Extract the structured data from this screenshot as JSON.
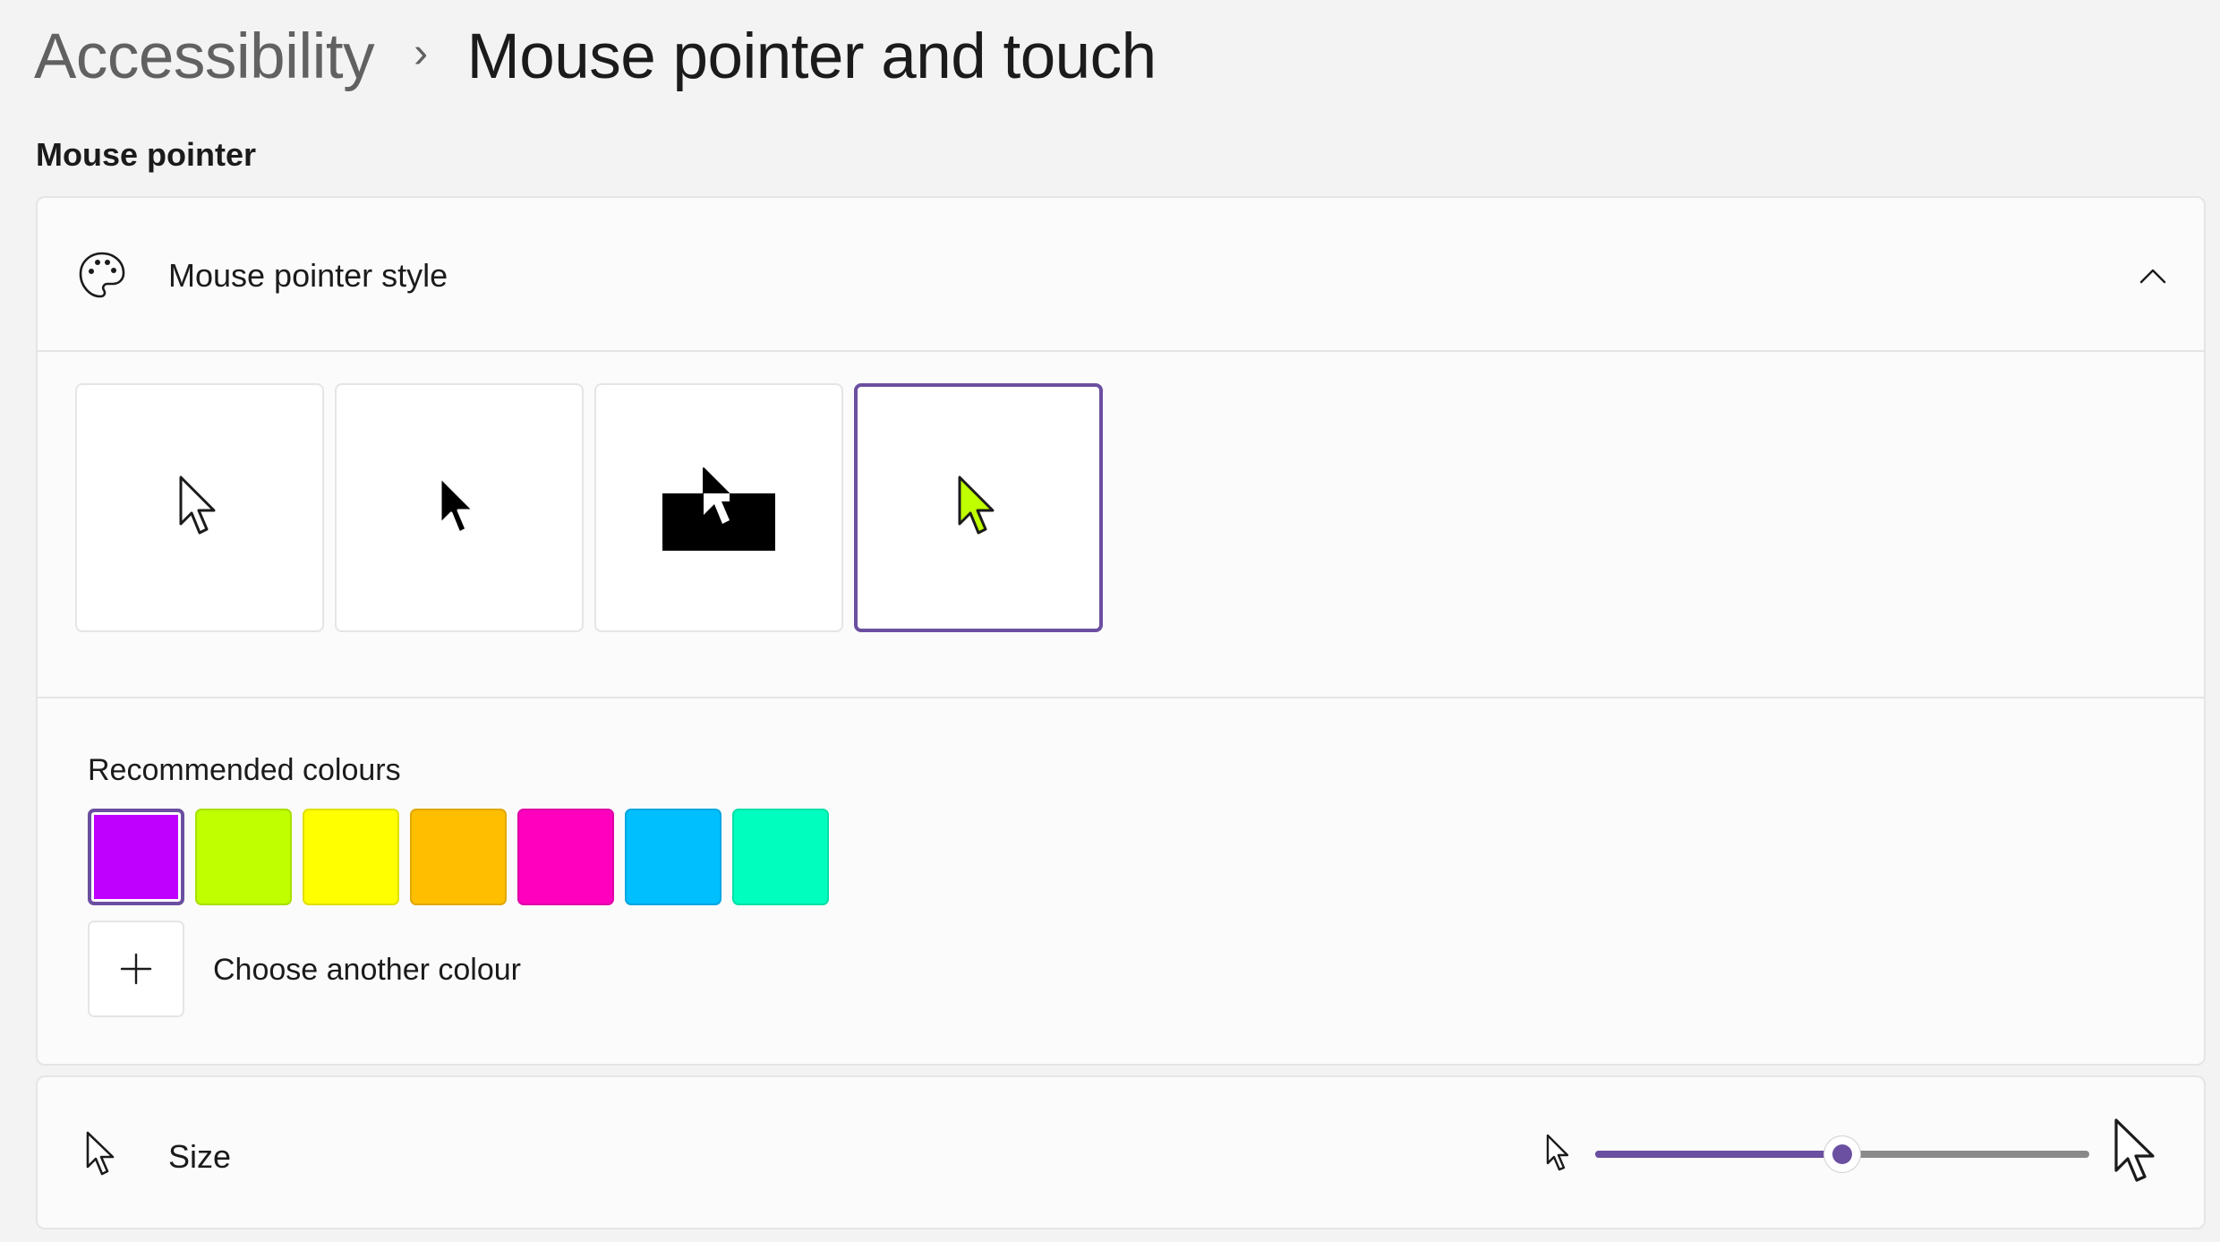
{
  "breadcrumb": {
    "parent": "Accessibility",
    "separator": "›",
    "current": "Mouse pointer and touch"
  },
  "section_title": "Mouse pointer",
  "pointer_style": {
    "label": "Mouse pointer style",
    "icon": "palette-icon",
    "expand_icon": "chevron-up-icon",
    "options": [
      {
        "name": "white",
        "selected": false
      },
      {
        "name": "black",
        "selected": false
      },
      {
        "name": "inverted",
        "selected": false
      },
      {
        "name": "custom",
        "selected": true
      }
    ]
  },
  "colours": {
    "label": "Recommended colours",
    "swatches": [
      {
        "color": "#bf00ff",
        "selected": true
      },
      {
        "color": "#bfff00",
        "selected": false
      },
      {
        "color": "#ffff00",
        "selected": false
      },
      {
        "color": "#ffbf00",
        "selected": false
      },
      {
        "color": "#ff00bf",
        "selected": false
      },
      {
        "color": "#00bfff",
        "selected": false
      },
      {
        "color": "#00ffbf",
        "selected": false
      }
    ],
    "add_label": "Choose another colour",
    "add_icon": "plus-icon"
  },
  "size": {
    "label": "Size",
    "icon": "pointer-icon",
    "slider_value": 0.5,
    "accent": "#6b4fa0"
  },
  "accent_color": "#6b4fa0",
  "custom_pointer_color": "#bfff00"
}
